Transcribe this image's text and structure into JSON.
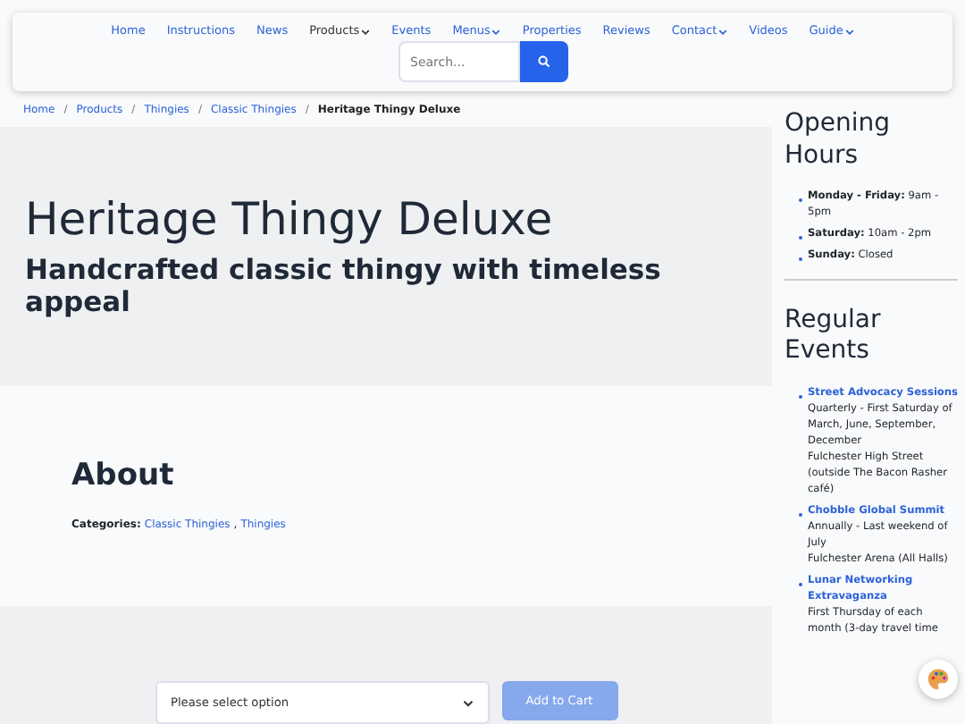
{
  "nav": {
    "items": [
      {
        "label": "Home",
        "selected": false,
        "dropdown": false
      },
      {
        "label": "Instructions",
        "selected": false,
        "dropdown": false
      },
      {
        "label": "News",
        "selected": false,
        "dropdown": false
      },
      {
        "label": "Products",
        "selected": true,
        "dropdown": true
      },
      {
        "label": "Events",
        "selected": false,
        "dropdown": false
      },
      {
        "label": "Menus",
        "selected": false,
        "dropdown": true
      },
      {
        "label": "Properties",
        "selected": false,
        "dropdown": false
      },
      {
        "label": "Reviews",
        "selected": false,
        "dropdown": false
      },
      {
        "label": "Contact",
        "selected": false,
        "dropdown": true
      },
      {
        "label": "Videos",
        "selected": false,
        "dropdown": false
      },
      {
        "label": "Guide",
        "selected": false,
        "dropdown": true
      }
    ],
    "search": {
      "placeholder": "Search..."
    }
  },
  "breadcrumb": {
    "links": [
      "Home",
      "Products",
      "Thingies",
      "Classic Thingies"
    ],
    "current": "Heritage Thingy Deluxe",
    "separator": "/"
  },
  "hero": {
    "title": "Heritage Thingy Deluxe",
    "subtitle": "Handcrafted classic thingy with timeless appeal"
  },
  "about": {
    "heading": "About",
    "categories_label": "Categories:",
    "categories": [
      "Classic Thingies",
      "Thingies"
    ],
    "separator": ","
  },
  "cart": {
    "select": {
      "value": "Please select option"
    },
    "button": {
      "label": "Add to Cart",
      "disabled": true
    }
  },
  "sidebar": {
    "hours": {
      "heading": "Opening Hours",
      "items": [
        "**Monday - Friday:** 9am - 5pm",
        "**Saturday:** 10am - 2pm",
        "**Sunday:** Closed"
      ]
    },
    "events": {
      "heading": "Regular Events",
      "items": [
        {
          "title": "Street Advocacy Sessions",
          "when": "Quarterly - First Saturday of March, June, September, December",
          "where": "Fulchester High Street (outside The Bacon Rasher café)"
        },
        {
          "title": "Chobble Global Summit",
          "when": "Annually - Last weekend of July",
          "where": "Fulchester Arena (All Halls)"
        },
        {
          "title": "Lunar Networking Extravaganza",
          "when": "First Thursday of each month (3-day travel time"
        }
      ]
    }
  }
}
